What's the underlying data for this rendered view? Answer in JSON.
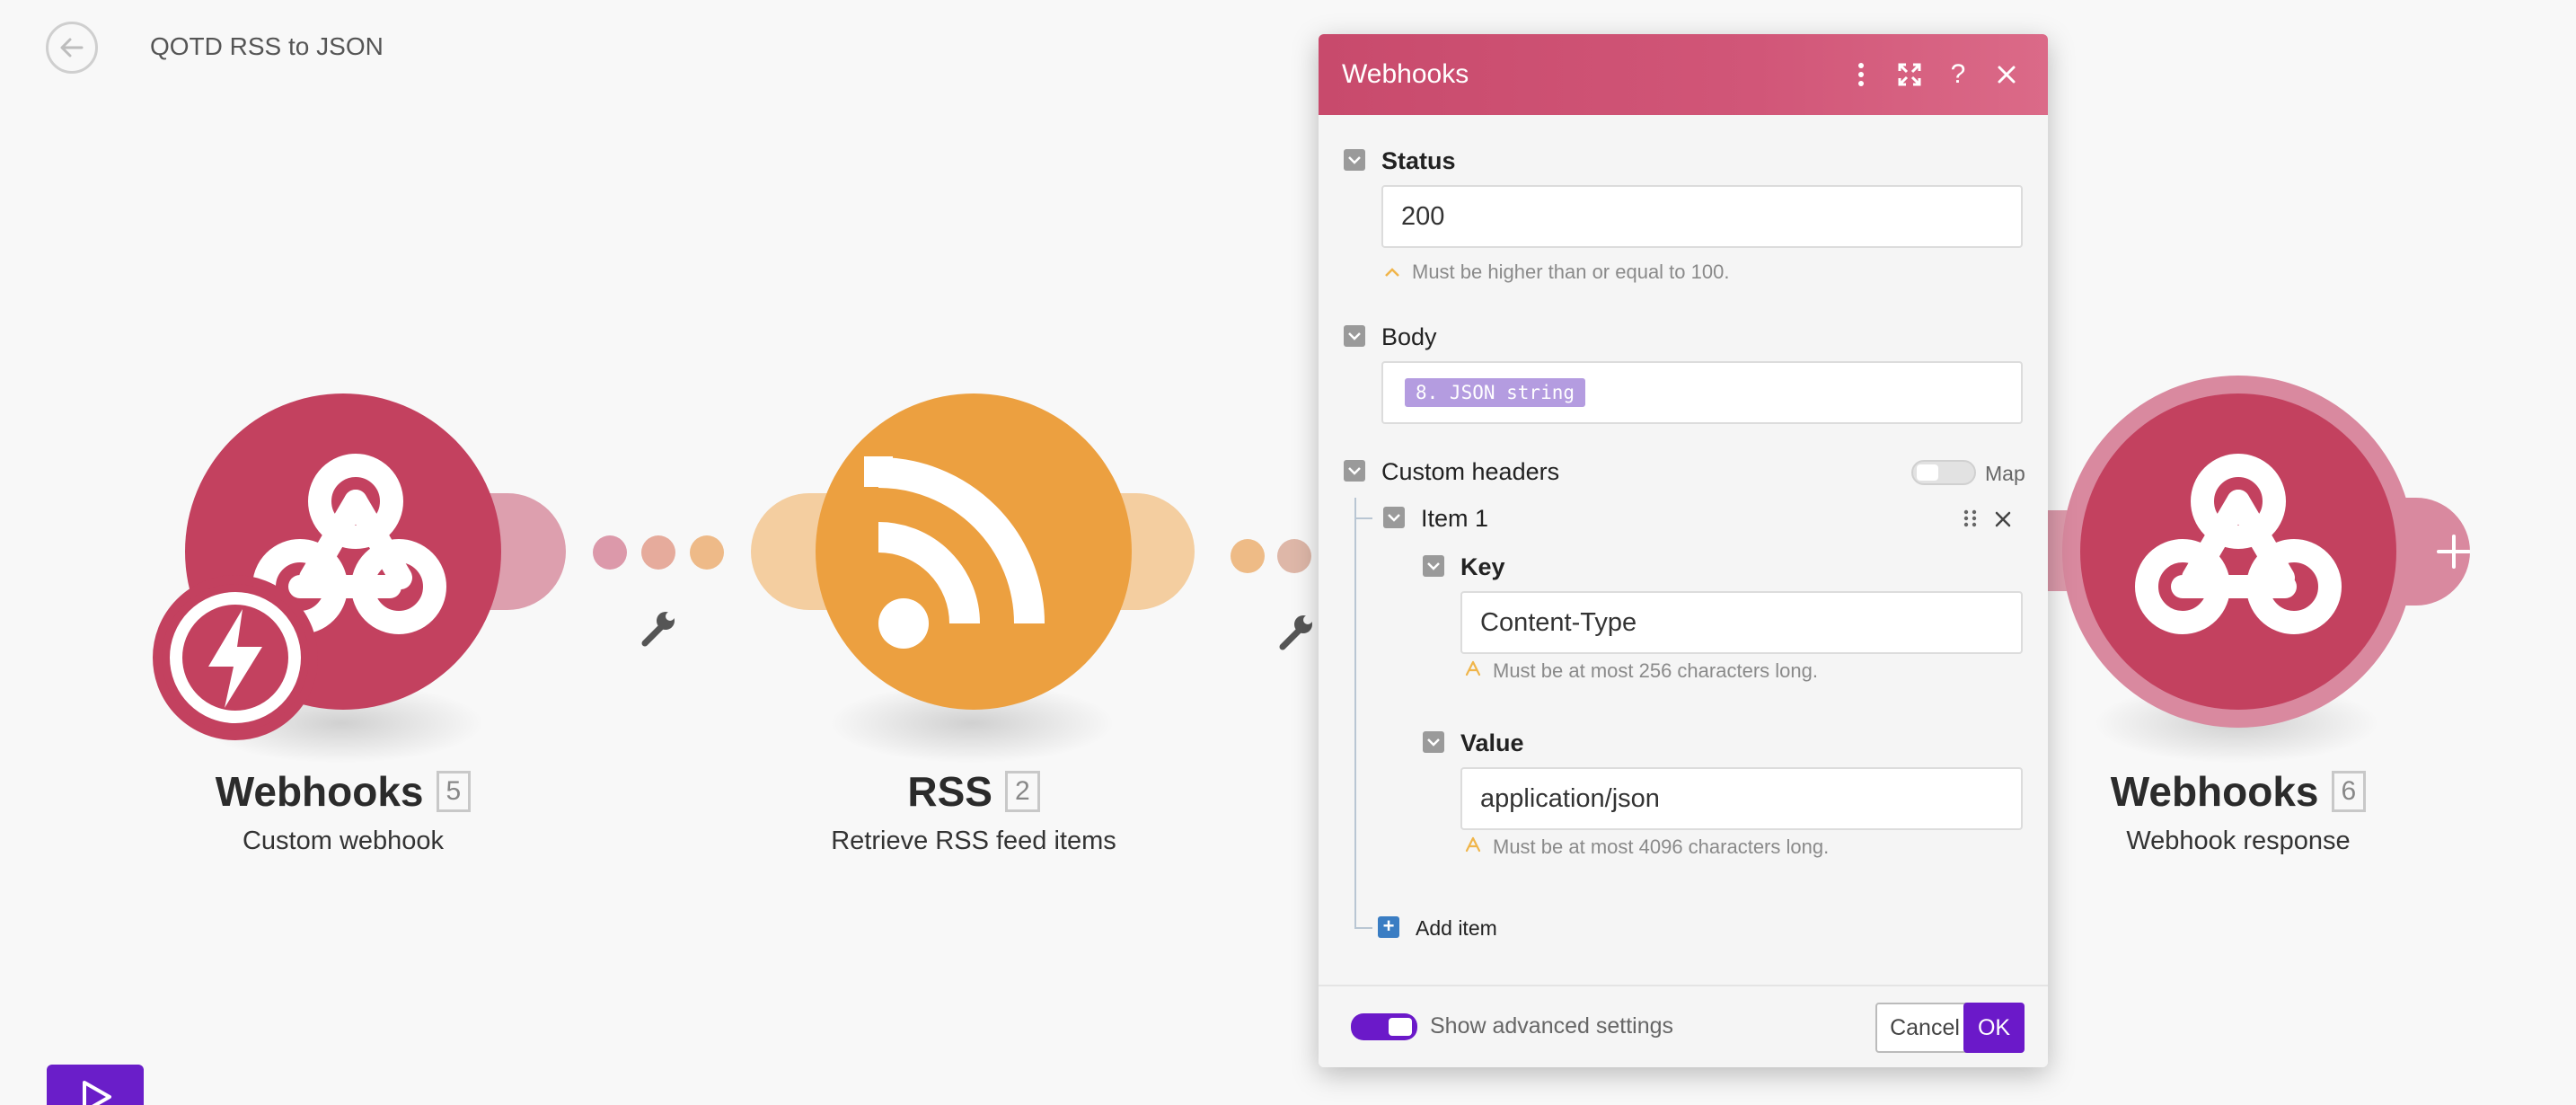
{
  "scenario": {
    "title": "QOTD RSS to JSON"
  },
  "colors": {
    "webhooks": "#c3415f",
    "rss": "#eca040",
    "accent": "#6b19c9"
  },
  "nodes": [
    {
      "name": "Webhooks",
      "id": "5",
      "subtitle": "Custom webhook",
      "icon": "webhook-icon",
      "trigger_icon": "lightning-icon"
    },
    {
      "name": "RSS",
      "id": "2",
      "subtitle": "Retrieve RSS feed items",
      "icon": "rss-icon"
    },
    {
      "name": "Webhooks",
      "id": "6",
      "subtitle": "Webhook response",
      "icon": "webhook-icon"
    }
  ],
  "dialog": {
    "title": "Webhooks",
    "status": {
      "label": "Status",
      "value": "200",
      "hint": "Must be higher than or equal to 100."
    },
    "body": {
      "label": "Body",
      "pill": "8. JSON string"
    },
    "custom_headers": {
      "label": "Custom headers",
      "map_label": "Map",
      "item": {
        "label": "Item 1",
        "key": {
          "label": "Key",
          "value": "Content-Type",
          "hint": "Must be at most 256 characters long."
        },
        "value": {
          "label": "Value",
          "value": "application/json",
          "hint": "Must be at most 4096 characters long."
        }
      },
      "add_item": "Add item"
    },
    "footer": {
      "advanced": "Show advanced settings",
      "cancel": "Cancel",
      "ok": "OK"
    }
  }
}
